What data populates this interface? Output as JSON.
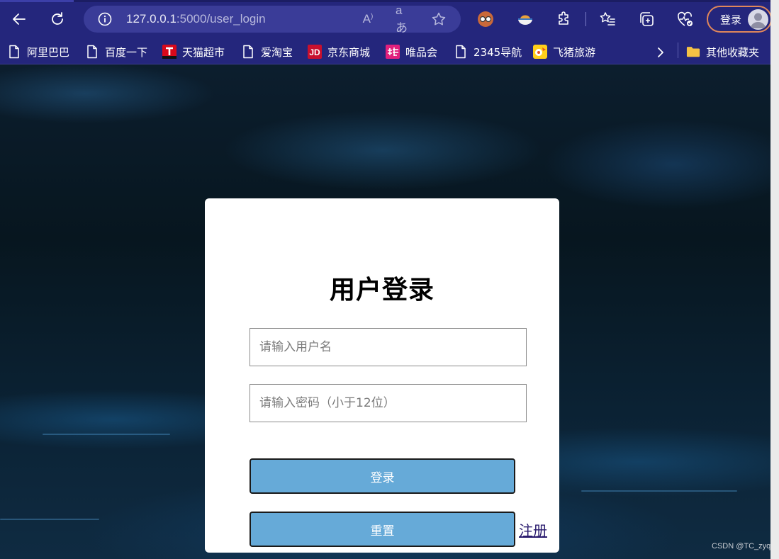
{
  "browser": {
    "url_host": "127.0.0.1",
    "url_rest": ":5000/user_login",
    "profile_label": "登录",
    "bookmarks": [
      {
        "label": "阿里巴巴",
        "icon": "page-icon"
      },
      {
        "label": "百度一下",
        "icon": "page-icon"
      },
      {
        "label": "天猫超市",
        "icon": "tmall-icon"
      },
      {
        "label": "爱淘宝",
        "icon": "page-icon"
      },
      {
        "label": "京东商城",
        "icon": "jd-icon"
      },
      {
        "label": "唯品会",
        "icon": "vip-icon"
      },
      {
        "label": "2345导航",
        "icon": "page-icon"
      },
      {
        "label": "飞猪旅游",
        "icon": "fliggy-icon"
      }
    ],
    "other_bookmarks": "其他收藏夹"
  },
  "login": {
    "title": "用户登录",
    "username_placeholder": "请输入用户名",
    "password_placeholder": "请输入密码（小于12位）",
    "login_button": "登录",
    "reset_button": "重置",
    "register_link": "注册"
  },
  "watermark": "CSDN @TC_zyq",
  "colors": {
    "chrome": "#24267c",
    "button": "#66aad8",
    "profile_border": "#e0875b"
  }
}
